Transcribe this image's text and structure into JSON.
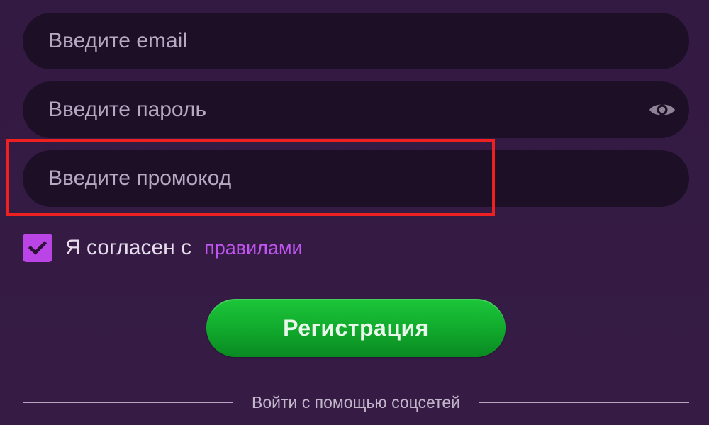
{
  "form": {
    "email": {
      "value": "",
      "placeholder": "Введите email"
    },
    "password": {
      "value": "",
      "placeholder": "Введите пароль",
      "toggle_icon": "eye-icon"
    },
    "promo": {
      "value": "",
      "placeholder": "Введите промокод"
    }
  },
  "agreement": {
    "checked": true,
    "text": "Я согласен с",
    "link_label": "правилами"
  },
  "register": {
    "label": "Регистрация"
  },
  "social": {
    "divider_label": "Войти с помощью соцсетей"
  },
  "colors": {
    "background": "#341b43",
    "field_bg": "#1d0f26",
    "accent_purple": "#bb44e6",
    "link_purple": "#c055f0",
    "button_green": "#10a82c",
    "highlight_red": "#ee2020"
  }
}
